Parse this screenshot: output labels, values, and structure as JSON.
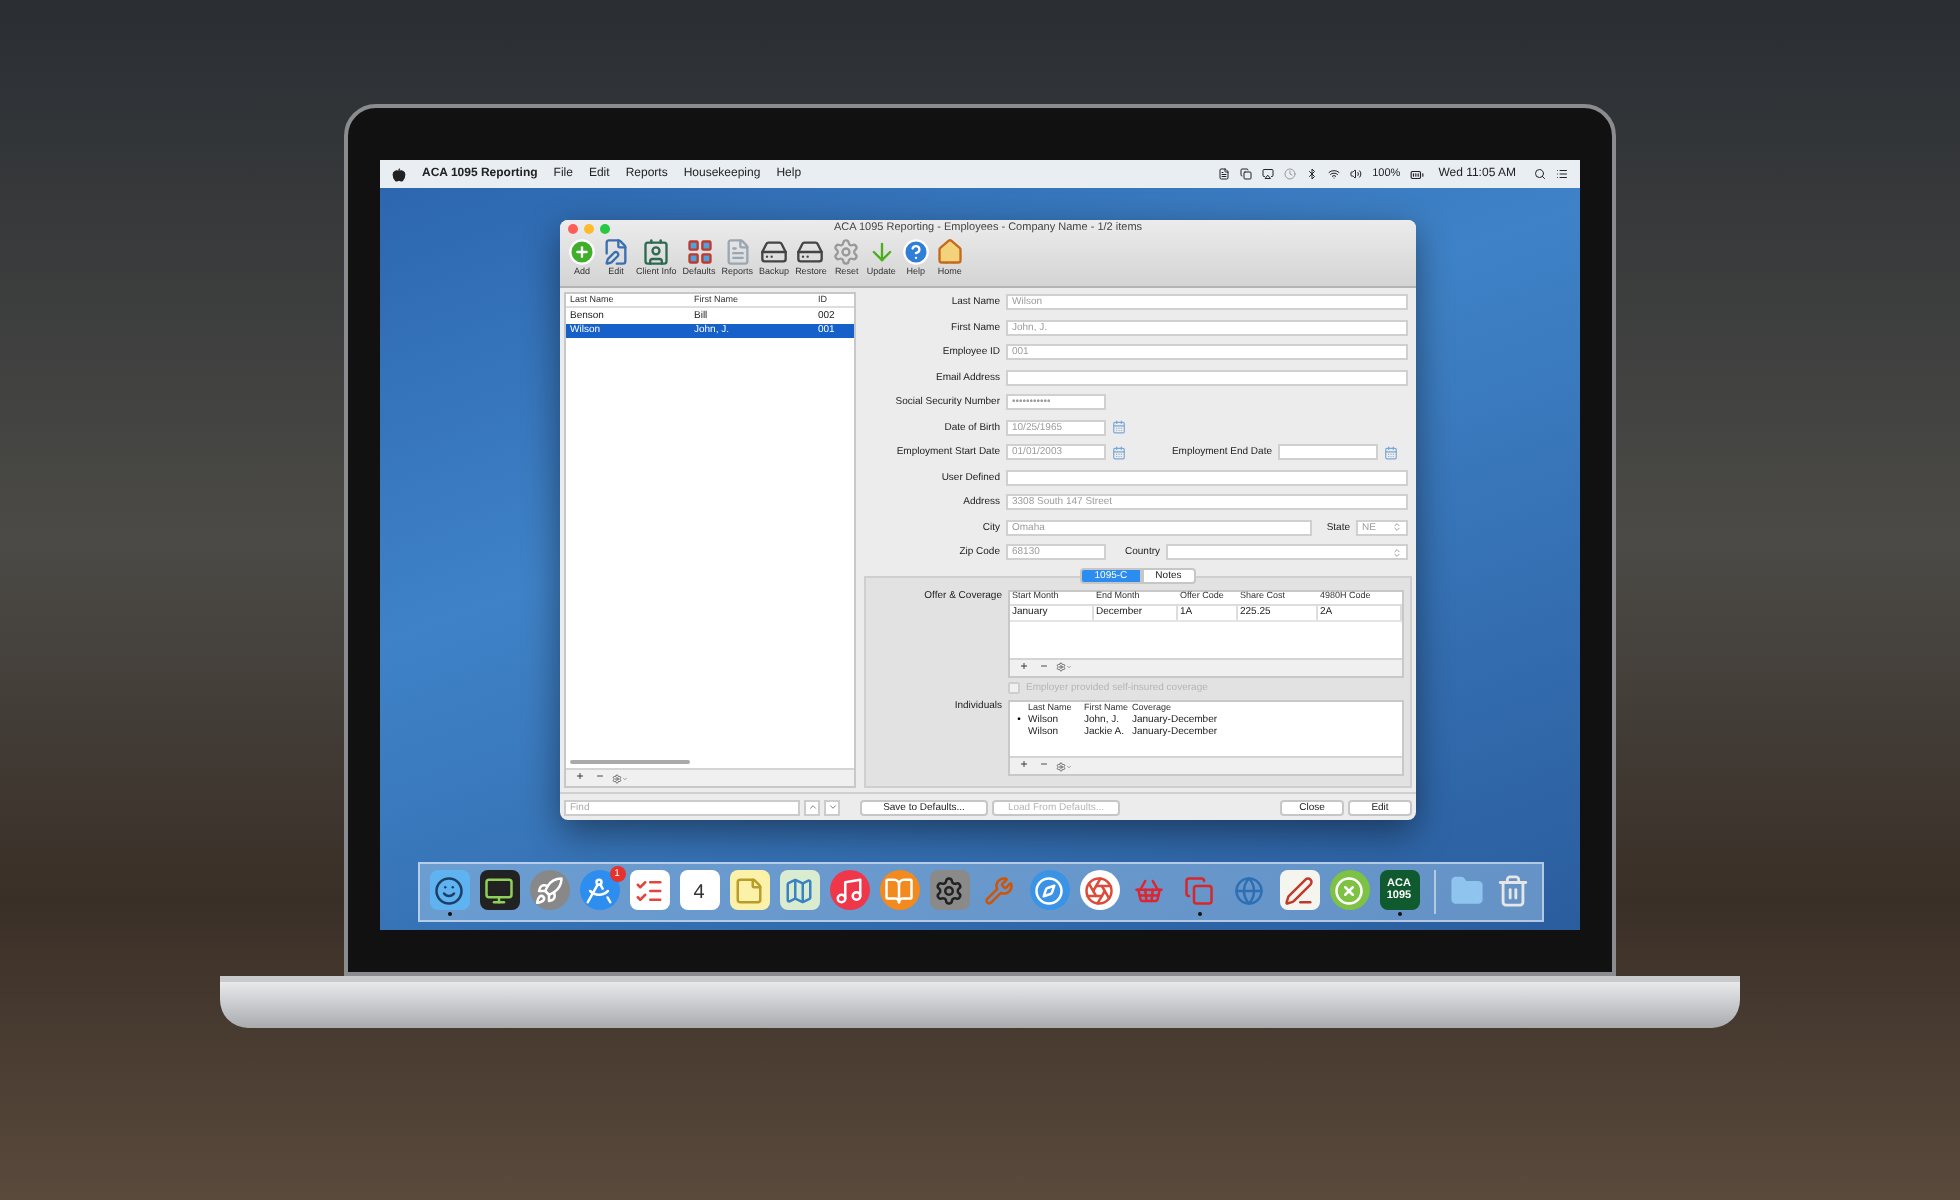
{
  "menu_bar": {
    "app_name": "ACA 1095 Reporting",
    "menus": [
      "File",
      "Edit",
      "Reports",
      "Housekeeping",
      "Help"
    ],
    "battery": "100%",
    "clock": "Wed 11:05 AM"
  },
  "window": {
    "title": "ACA 1095 Reporting - Employees - Company Name - 1/2 items",
    "toolbar": [
      {
        "label": "Add",
        "kind": "add"
      },
      {
        "label": "Edit",
        "kind": "edit"
      },
      {
        "label": "Client Info",
        "kind": "client"
      },
      {
        "label": "Defaults",
        "kind": "grid"
      },
      {
        "label": "Reports",
        "kind": "document"
      },
      {
        "label": "Backup",
        "kind": "drive"
      },
      {
        "label": "Restore",
        "kind": "drive"
      },
      {
        "label": "Reset",
        "kind": "gear"
      },
      {
        "label": "Update",
        "kind": "arrow"
      },
      {
        "label": "Help",
        "kind": "help"
      },
      {
        "label": "Home",
        "kind": "home"
      }
    ],
    "employee_list": {
      "columns": [
        "Last Name",
        "First Name",
        "ID"
      ],
      "rows": [
        {
          "cells": [
            "Benson",
            "Bill",
            "002"
          ],
          "selected": false
        },
        {
          "cells": [
            "Wilson",
            "John, J.",
            "001"
          ],
          "selected": true
        }
      ],
      "controls": [
        "+",
        "−"
      ]
    },
    "fields": [
      {
        "label": "Last Name",
        "value": "Wilson",
        "kind": "text"
      },
      {
        "label": "First Name",
        "value": "John, J.",
        "kind": "text"
      },
      {
        "label": "Employee ID",
        "value": "001",
        "kind": "text"
      },
      {
        "label": "Email Address",
        "kind": "text"
      },
      {
        "label": "Social Security Number",
        "value": "•••••••••••",
        "kind": "short"
      },
      {
        "label": "Date of Birth",
        "value": "10/25/1965",
        "kind": "date"
      },
      {
        "label": "Employment Start Date",
        "value": "01/01/2003",
        "kind": "date_range",
        "end_label": "Employment End Date"
      },
      {
        "label": "User Defined",
        "kind": "text"
      },
      {
        "label": "Address",
        "value": "3308 South 147 Street",
        "kind": "text"
      },
      {
        "label": "City",
        "value": "Omaha",
        "kind": "city_state",
        "state_label": "State",
        "state_value": "NE"
      },
      {
        "label": "Zip Code",
        "value": "68130",
        "kind": "zip_country",
        "country_label": "Country"
      }
    ],
    "tabs": [
      {
        "label": "1095-C",
        "selected": true
      },
      {
        "label": "Notes",
        "selected": false
      }
    ],
    "offer_coverage": {
      "label": "Offer & Coverage",
      "columns": [
        "Start Month",
        "End Month",
        "Offer Code",
        "Share Cost",
        "4980H Code"
      ],
      "rows": [
        [
          "January",
          "December",
          "1A",
          "225.25",
          "2A"
        ]
      ],
      "controls": [
        "+",
        "−"
      ]
    },
    "self_insured": {
      "label": "Employer provided self-insured coverage",
      "checked": false,
      "disabled": true
    },
    "individuals": {
      "label": "Individuals",
      "columns": [
        "Last Name",
        "First Name",
        "Coverage"
      ],
      "rows": [
        {
          "marker": "•",
          "cells": [
            "Wilson",
            "John, J.",
            "January-December"
          ]
        },
        {
          "cells": [
            "Wilson",
            "Jackie A.",
            "January-December"
          ]
        }
      ],
      "controls": [
        "+",
        "−"
      ]
    },
    "find": {
      "placeholder": "Find"
    },
    "left_buttons": [
      {
        "label": "Save to Defaults...",
        "disabled": false
      },
      {
        "label": "Load From Defaults...",
        "disabled": true
      }
    ],
    "right_buttons": [
      {
        "label": "Close"
      },
      {
        "label": "Edit"
      }
    ]
  },
  "dock": {
    "apps": [
      {
        "kind": "finder",
        "running": true
      },
      {
        "kind": "monitor",
        "running": false
      },
      {
        "kind": "rocket",
        "running": false
      },
      {
        "kind": "store",
        "running": false,
        "badge": "1"
      },
      {
        "kind": "checklist",
        "running": false
      },
      {
        "kind": "calendar",
        "running": false,
        "text": "4"
      },
      {
        "kind": "note",
        "running": false
      },
      {
        "kind": "map",
        "running": false
      },
      {
        "kind": "music",
        "running": false
      },
      {
        "kind": "book",
        "running": false
      },
      {
        "kind": "settings",
        "running": false
      },
      {
        "kind": "wrench",
        "running": false
      },
      {
        "kind": "compass",
        "running": false
      },
      {
        "kind": "aperture",
        "running": false
      },
      {
        "kind": "basket",
        "running": false
      },
      {
        "kind": "squares",
        "running": true
      },
      {
        "kind": "globe",
        "running": false
      },
      {
        "kind": "pen",
        "running": false
      },
      {
        "kind": "xcircle",
        "running": false
      },
      {
        "kind": "tile",
        "running": true,
        "text": "ACA 1095"
      }
    ],
    "stacks": [
      {
        "kind": "folder"
      },
      {
        "kind": "trash"
      }
    ]
  }
}
